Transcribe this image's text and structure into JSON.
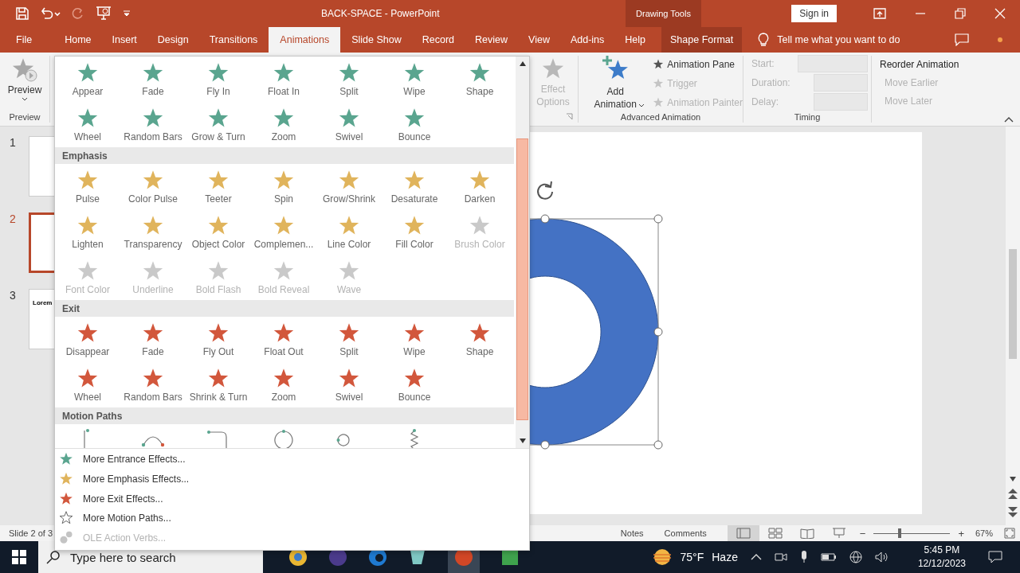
{
  "window": {
    "title": "BACK-SPACE  -  PowerPoint",
    "context_label": "Drawing Tools",
    "sign_in": "Sign in"
  },
  "tabs": [
    {
      "label": "File",
      "selected": false
    },
    {
      "label": "Home",
      "selected": false
    },
    {
      "label": "Insert",
      "selected": false
    },
    {
      "label": "Design",
      "selected": false
    },
    {
      "label": "Transitions",
      "selected": false
    },
    {
      "label": "Animations",
      "selected": true
    },
    {
      "label": "Slide Show",
      "selected": false
    },
    {
      "label": "Record",
      "selected": false
    },
    {
      "label": "Review",
      "selected": false
    },
    {
      "label": "View",
      "selected": false
    },
    {
      "label": "Add-ins",
      "selected": false
    },
    {
      "label": "Help",
      "selected": false
    },
    {
      "label": "Shape Format",
      "selected": false,
      "contextual": true
    }
  ],
  "tell_me": "Tell me what you want to do",
  "ribbon": {
    "preview": {
      "label": "Preview",
      "group": "Preview"
    },
    "effect_options": {
      "label": "Effect Options",
      "disabled": true
    },
    "add_animation": {
      "label": "Add Animation"
    },
    "advanced": [
      {
        "label": "Animation Pane",
        "disabled": false
      },
      {
        "label": "Trigger",
        "disabled": true
      },
      {
        "label": "Animation Painter",
        "disabled": true
      }
    ],
    "advanced_group": "Advanced Animation",
    "timing": [
      {
        "label": "Start:",
        "disabled": true
      },
      {
        "label": "Duration:",
        "disabled": true
      },
      {
        "label": "Delay:",
        "disabled": true
      }
    ],
    "timing_group": "Timing",
    "reorder": {
      "title": "Reorder Animation",
      "items": [
        {
          "label": "Move Earlier",
          "disabled": true
        },
        {
          "label": "Move Later",
          "disabled": true
        }
      ]
    }
  },
  "slides": [
    {
      "number": "1",
      "selected": false
    },
    {
      "number": "2",
      "selected": true
    },
    {
      "number": "3",
      "selected": false,
      "title": "Lorem"
    }
  ],
  "gallery": {
    "sections": [
      {
        "color": "#5aa58f",
        "items": [
          {
            "label": "Appear",
            "disabled": false
          },
          {
            "label": "Fade",
            "disabled": false
          },
          {
            "label": "Fly In",
            "disabled": false
          },
          {
            "label": "Float In",
            "disabled": false
          },
          {
            "label": "Split",
            "disabled": false
          },
          {
            "label": "Wipe",
            "disabled": false
          },
          {
            "label": "Shape",
            "disabled": false
          },
          {
            "label": "Wheel",
            "disabled": false
          },
          {
            "label": "Random Bars",
            "disabled": false
          },
          {
            "label": "Grow & Turn",
            "disabled": false
          },
          {
            "label": "Zoom",
            "disabled": false
          },
          {
            "label": "Swivel",
            "disabled": false
          },
          {
            "label": "Bounce",
            "disabled": false
          }
        ]
      },
      {
        "title": "Emphasis",
        "color": "#e0b45c",
        "items": [
          {
            "label": "Pulse",
            "disabled": false
          },
          {
            "label": "Color Pulse",
            "disabled": false
          },
          {
            "label": "Teeter",
            "disabled": false
          },
          {
            "label": "Spin",
            "disabled": false
          },
          {
            "label": "Grow/Shrink",
            "disabled": false
          },
          {
            "label": "Desaturate",
            "disabled": false
          },
          {
            "label": "Darken",
            "disabled": false
          },
          {
            "label": "Lighten",
            "disabled": false
          },
          {
            "label": "Transparency",
            "disabled": false
          },
          {
            "label": "Object Color",
            "disabled": false
          },
          {
            "label": "Complemen...",
            "disabled": false
          },
          {
            "label": "Line Color",
            "disabled": false
          },
          {
            "label": "Fill Color",
            "disabled": false
          },
          {
            "label": "Brush Color",
            "disabled": true
          },
          {
            "label": "Font Color",
            "disabled": true
          },
          {
            "label": "Underline",
            "disabled": true
          },
          {
            "label": "Bold Flash",
            "disabled": true
          },
          {
            "label": "Bold Reveal",
            "disabled": true
          },
          {
            "label": "Wave",
            "disabled": true
          }
        ]
      },
      {
        "title": "Exit",
        "color": "#d2573c",
        "items": [
          {
            "label": "Disappear",
            "disabled": false
          },
          {
            "label": "Fade",
            "disabled": false
          },
          {
            "label": "Fly Out",
            "disabled": false
          },
          {
            "label": "Float Out",
            "disabled": false
          },
          {
            "label": "Split",
            "disabled": false
          },
          {
            "label": "Wipe",
            "disabled": false
          },
          {
            "label": "Shape",
            "disabled": false
          },
          {
            "label": "Wheel",
            "disabled": false
          },
          {
            "label": "Random Bars",
            "disabled": false
          },
          {
            "label": "Shrink & Turn",
            "disabled": false
          },
          {
            "label": "Zoom",
            "disabled": false
          },
          {
            "label": "Swivel",
            "disabled": false
          },
          {
            "label": "Bounce",
            "disabled": false
          }
        ]
      },
      {
        "title": "Motion Paths",
        "paths": [
          {
            "kind": "line"
          },
          {
            "kind": "arc"
          },
          {
            "kind": "turn"
          },
          {
            "kind": "circle"
          },
          {
            "kind": "loop"
          },
          {
            "kind": "zigzag"
          }
        ]
      }
    ],
    "menu": [
      {
        "label": "More Entrance Effects...",
        "kind": "star",
        "color": "#5aa58f",
        "disabled": false
      },
      {
        "label": "More Emphasis Effects...",
        "kind": "star",
        "color": "#e0b45c",
        "disabled": false
      },
      {
        "label": "More Exit Effects...",
        "kind": "star",
        "color": "#d2573c",
        "disabled": false
      },
      {
        "label": "More Motion Paths...",
        "kind": "outline",
        "disabled": false
      },
      {
        "label": "OLE Action Verbs...",
        "kind": "gears",
        "disabled": true
      }
    ]
  },
  "status_bar": {
    "slide": "Slide 2 of 3",
    "notes": "Notes",
    "comments": "Comments",
    "views": [
      {
        "kind": "normal",
        "selected": true
      },
      {
        "kind": "sorter",
        "selected": false
      },
      {
        "kind": "reading",
        "selected": false
      },
      {
        "kind": "show",
        "selected": false
      }
    ],
    "zoom_out": "−",
    "zoom_slider": {
      "level": 0.32
    },
    "zoom_in": "+",
    "zoom": "67%"
  },
  "taskbar": {
    "search_placeholder": "Type here to search",
    "temperature": "75°F",
    "weather": "Haze",
    "time": "5:45 PM",
    "date": "12/12/2023"
  }
}
